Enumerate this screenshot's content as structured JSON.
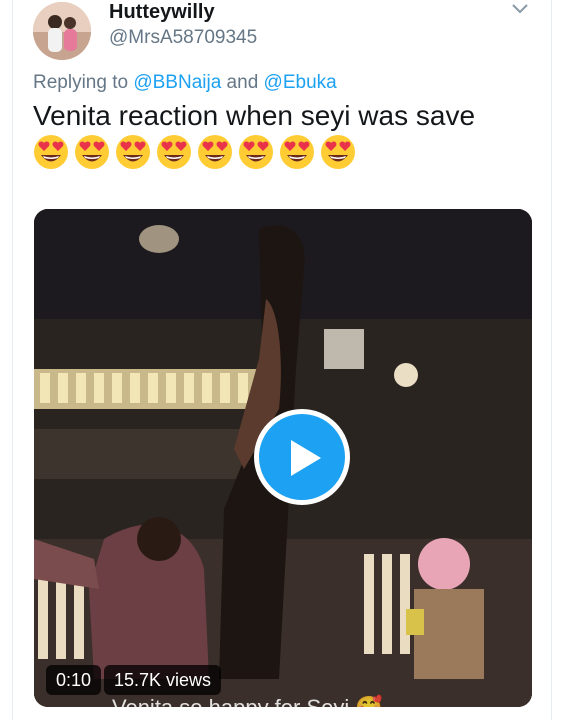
{
  "tweet": {
    "display_name": "Hutteywilly",
    "handle": "@MrsA58709345",
    "reply_prefix": "Replying to ",
    "reply_user_1": "@BBNaija",
    "reply_and": " and ",
    "reply_user_2": "@Ebuka",
    "text": "Venita reaction when seyi was save",
    "emoji_icons": [
      "heart-eyes-emoji",
      "heart-eyes-emoji",
      "heart-eyes-emoji",
      "heart-eyes-emoji",
      "heart-eyes-emoji",
      "heart-eyes-emoji",
      "heart-eyes-emoji",
      "heart-eyes-emoji"
    ]
  },
  "video": {
    "duration": "0:10",
    "views": "15.7K views",
    "caption": "Venita so happy for Seyi 🥰",
    "play_icon": "play-icon"
  },
  "colors": {
    "link": "#1da1f2",
    "secondary_text": "#657786",
    "primary_text": "#14171a"
  }
}
